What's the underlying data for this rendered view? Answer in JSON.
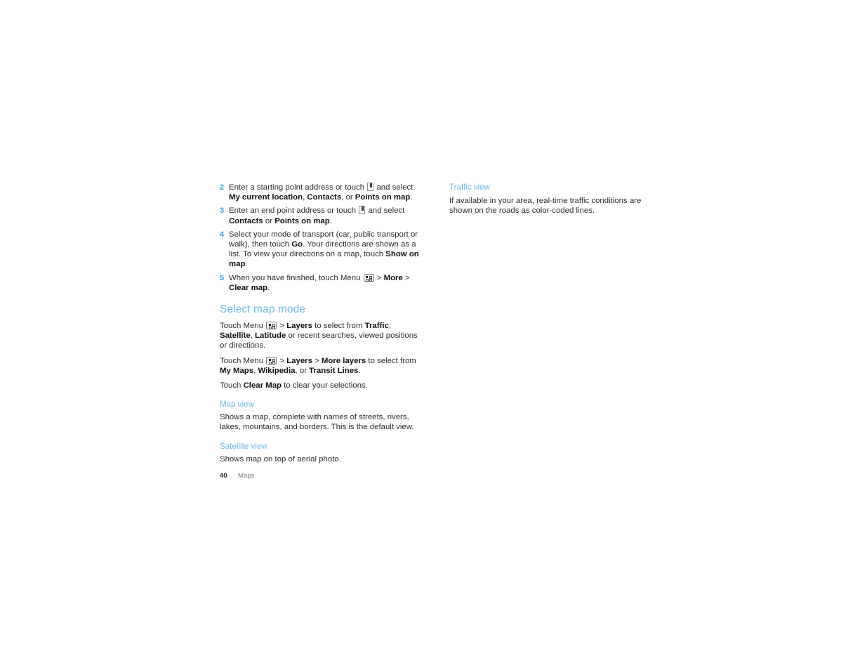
{
  "document": {
    "page_number": "40",
    "chapter": "Maps"
  },
  "colors": {
    "heading_blue": "#6cb9e8",
    "step_number_blue": "#2c9fe0",
    "body_text": "#2b2b2b",
    "footer_gray": "#7d7d7d"
  },
  "left_column": {
    "steps": [
      {
        "number": "2",
        "parts": [
          {
            "text": "Enter a starting point address or touch ",
            "bold": false
          },
          {
            "icon": "bookmark-icon"
          },
          {
            "text": " and select ",
            "bold": false
          },
          {
            "text": "My current location",
            "bold": true
          },
          {
            "text": ", ",
            "bold": false
          },
          {
            "text": "Contacts",
            "bold": true
          },
          {
            "text": ", or ",
            "bold": false
          },
          {
            "text": "Points on map",
            "bold": true
          },
          {
            "text": ".",
            "bold": false
          }
        ]
      },
      {
        "number": "3",
        "parts": [
          {
            "text": "Enter an end point address or touch ",
            "bold": false
          },
          {
            "icon": "bookmark-icon"
          },
          {
            "text": " and select ",
            "bold": false
          },
          {
            "text": "Contacts",
            "bold": true
          },
          {
            "text": " or ",
            "bold": false
          },
          {
            "text": "Points on map",
            "bold": true
          },
          {
            "text": ".",
            "bold": false
          }
        ]
      },
      {
        "number": "4",
        "parts": [
          {
            "text": "Select your mode of transport (car, public transport or walk), then touch ",
            "bold": false
          },
          {
            "text": "Go",
            "bold": true
          },
          {
            "text": ". Your directions are shown as a list. To view your directions on a map, touch ",
            "bold": false
          },
          {
            "text": "Show on map",
            "bold": true
          },
          {
            "text": ".",
            "bold": false
          }
        ]
      },
      {
        "number": "5",
        "parts": [
          {
            "text": "When you have finished, touch Menu ",
            "bold": false
          },
          {
            "icon": "menu-icon"
          },
          {
            "text": " > ",
            "bold": false
          },
          {
            "text": "More",
            "bold": true
          },
          {
            "text": " > ",
            "bold": false
          },
          {
            "text": "Clear map",
            "bold": true
          },
          {
            "text": ".",
            "bold": false
          }
        ]
      }
    ],
    "section_heading": "Select map mode",
    "paragraphs": [
      {
        "parts": [
          {
            "text": "Touch Menu ",
            "bold": false
          },
          {
            "icon": "menu-icon"
          },
          {
            "text": " > ",
            "bold": false
          },
          {
            "text": "Layers",
            "bold": true
          },
          {
            "text": " to select from ",
            "bold": false
          },
          {
            "text": "Traffic",
            "bold": true
          },
          {
            "text": ", ",
            "bold": false
          },
          {
            "text": "Satellite",
            "bold": true
          },
          {
            "text": ", ",
            "bold": false
          },
          {
            "text": "Latitude",
            "bold": true
          },
          {
            "text": " or recent searches, viewed positions or directions.",
            "bold": false
          }
        ]
      },
      {
        "parts": [
          {
            "text": "Touch Menu ",
            "bold": false
          },
          {
            "icon": "menu-icon"
          },
          {
            "text": " > ",
            "bold": false
          },
          {
            "text": "Layers",
            "bold": true
          },
          {
            "text": " > ",
            "bold": false
          },
          {
            "text": "More layers",
            "bold": true
          },
          {
            "text": " to select from ",
            "bold": false
          },
          {
            "text": "My Maps",
            "bold": true
          },
          {
            "text": ", ",
            "bold": false
          },
          {
            "text": "Wikipedia",
            "bold": true
          },
          {
            "text": ", or ",
            "bold": false
          },
          {
            "text": "Transit Lines",
            "bold": true
          },
          {
            "text": ".",
            "bold": false
          }
        ]
      },
      {
        "parts": [
          {
            "text": "Touch ",
            "bold": false
          },
          {
            "text": "Clear Map",
            "bold": true
          },
          {
            "text": " to clear your selections.",
            "bold": false
          }
        ]
      }
    ],
    "subsections": [
      {
        "heading": "Map view",
        "body": "Shows a map, complete with names of streets, rivers, lakes, mountains, and borders. This is the default view."
      },
      {
        "heading": "Satellite view",
        "body": "Shows map on top of aerial photo."
      }
    ]
  },
  "right_column": {
    "subsections": [
      {
        "heading": "Traffic view",
        "body": "If available in your area, real-time traffic conditions are shown on the roads as color-coded lines."
      }
    ]
  }
}
